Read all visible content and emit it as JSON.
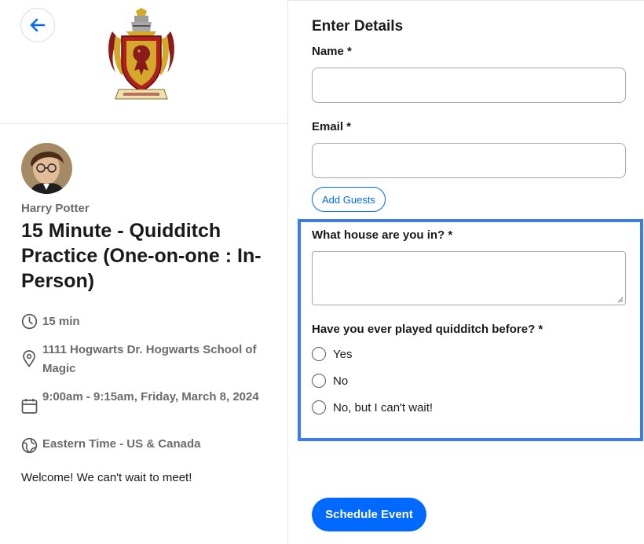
{
  "event": {
    "host_name": "Harry Potter",
    "title": "15 Minute - Quidditch Practice (One-on-one : In-Person)",
    "duration": "15 min",
    "location": "1111 Hogwarts Dr. Hogwarts School of Magic",
    "datetime": "9:00am - 9:15am, Friday, March 8, 2024",
    "timezone": "Eastern Time - US & Canada",
    "welcome_message": "Welcome! We can't wait to meet!"
  },
  "icons": {
    "back": "arrow-left-icon",
    "crest": "gryffindor-crest",
    "duration": "clock-icon",
    "location": "map-pin-icon",
    "datetime": "calendar-icon",
    "timezone": "globe-icon"
  },
  "form": {
    "section_title": "Enter Details",
    "name_label": "Name *",
    "name_value": "",
    "email_label": "Email *",
    "email_value": "",
    "add_guests_label": "Add Guests",
    "house_label": "What house are you in? *",
    "house_value": "",
    "quidditch_label": "Have you ever played quidditch before? *",
    "quidditch_options": [
      "Yes",
      "No",
      "No, but I can't wait!"
    ],
    "submit_label": "Schedule Event"
  },
  "colors": {
    "accent": "#0069ff",
    "highlight": "#3d7cf0",
    "crest_red": "#8b1a1a",
    "crest_gold": "#d4a82a"
  }
}
